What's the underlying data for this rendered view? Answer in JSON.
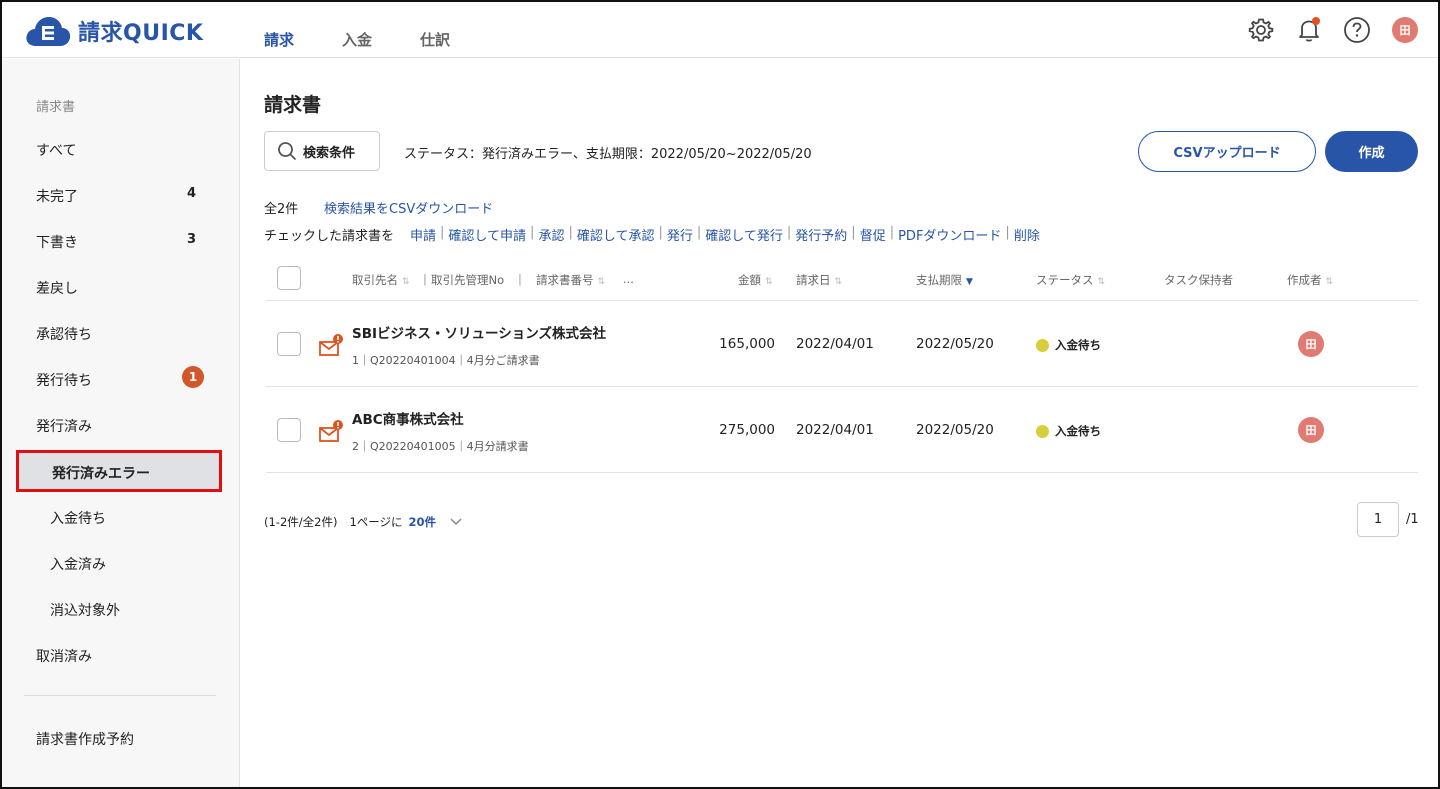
{
  "app": {
    "name": "請求QUICK"
  },
  "topnav": [
    {
      "label": "請求",
      "active": true
    },
    {
      "label": "入金",
      "active": false
    },
    {
      "label": "仕訳",
      "active": false
    }
  ],
  "header": {
    "avatar_initial": "田"
  },
  "sidebar": {
    "heading": "請求書",
    "items": [
      {
        "label": "すべて"
      },
      {
        "label": "未完了",
        "count": "4"
      },
      {
        "label": "下書き",
        "count": "3"
      },
      {
        "label": "差戻し"
      },
      {
        "label": "承認待ち"
      },
      {
        "label": "発行待ち",
        "badge": "1"
      },
      {
        "label": "発行済み"
      },
      {
        "label": "発行済みエラー",
        "selected": true
      },
      {
        "label": "入金待ち"
      },
      {
        "label": "入金済み"
      },
      {
        "label": "消込対象外"
      },
      {
        "label": "取消済み"
      }
    ],
    "footer_item": "請求書作成予約"
  },
  "main": {
    "title": "請求書",
    "search_button": "検索条件",
    "filter_summary": "ステータス：発行済みエラー、支払期限：2022/05/20~2022/05/20",
    "csv_upload_button": "CSVアップロード",
    "create_button": "作成",
    "total": "全2件",
    "csv_download_link": "検索結果をCSVダウンロード",
    "bulk_label": "チェックした請求書を",
    "bulk_actions": [
      "申請",
      "確認して申請",
      "承認",
      "確認して承認",
      "発行",
      "確認して発行",
      "発行予約",
      "督促",
      "PDFダウンロード",
      "削除"
    ]
  },
  "table": {
    "columns": {
      "customer": "取引先名",
      "customer_code": "取引先管理No",
      "invoice_no": "請求書番号",
      "more": "...",
      "amount": "金額",
      "invoice_date": "請求日",
      "due_date": "支払期限",
      "status": "ステータス",
      "task_owner": "タスク保持者",
      "creator": "作成者"
    },
    "rows": [
      {
        "customer": "SBIビジネス・ソリューションズ株式会社",
        "meta": "1｜Q20220401004｜4月分ご請求書",
        "amount": "165,000",
        "invoice_date": "2022/04/01",
        "due_date": "2022/05/20",
        "status": "入金待ち",
        "creator_initial": "田"
      },
      {
        "customer": "ABC商事株式会社",
        "meta": "2｜Q20220401005｜4月分請求書",
        "amount": "275,000",
        "invoice_date": "2022/04/01",
        "due_date": "2022/05/20",
        "status": "入金待ち",
        "creator_initial": "田"
      }
    ]
  },
  "pagination": {
    "range": "(1-2件/全2件)",
    "per_page_label": "1ページに",
    "per_page_value": "20件",
    "current_page": "1",
    "total_pages": "/1"
  },
  "colors": {
    "brand": "#2855a8",
    "highlight_border": "#e01010",
    "badge": "#d2572a",
    "avatar": "#e07b73",
    "status_waiting": "#d6cf3a",
    "alert_icon": "#e0531f"
  }
}
